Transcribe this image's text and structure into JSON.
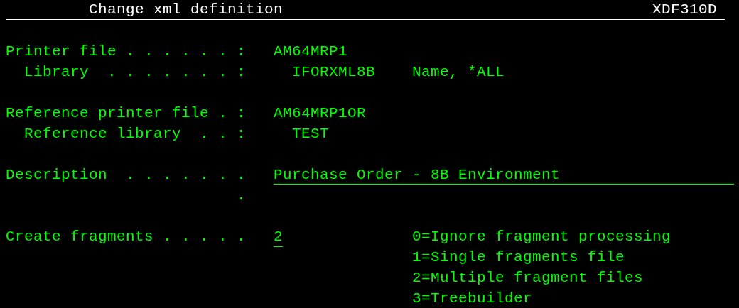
{
  "header": {
    "title": "Change xml definition",
    "screen_id": "XDF310D"
  },
  "fields": [
    {
      "kind": "output",
      "label": "Printer file . . . . . . :",
      "value": "AM64MRP1",
      "children": [
        {
          "kind": "output",
          "label": "Library  . . . . . . . :",
          "value": "IFORXML8B",
          "hint": "Name, *ALL"
        }
      ]
    },
    {
      "kind": "output",
      "label": "Reference printer file . :",
      "value": "AM64MRP1OR",
      "children": [
        {
          "kind": "output",
          "label": "Reference library  . . :",
          "value": "TEST"
        }
      ]
    },
    {
      "kind": "input_line",
      "label": "Description  . . . . . . .",
      "value": "Purchase Order - 8B Environment",
      "continuation": "."
    },
    {
      "kind": "input_short",
      "label": "Create fragments . . . . .",
      "value": "2",
      "options": [
        "0=Ignore fragment processing",
        "1=Single fragments file",
        "2=Multiple fragment files",
        "3=Treebuilder"
      ]
    }
  ]
}
